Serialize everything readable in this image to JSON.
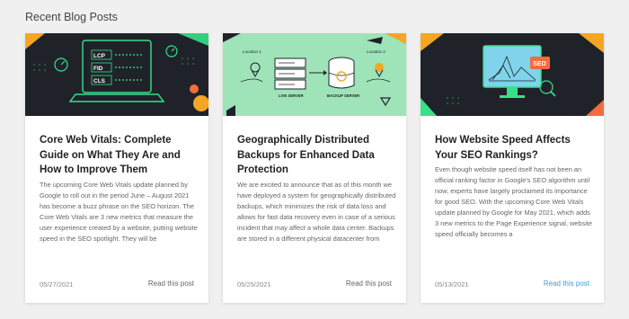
{
  "section": {
    "title": "Recent Blog Posts"
  },
  "posts": [
    {
      "image_alt": "core-web-vitals-laptop-illustration",
      "thumb_labels": [
        "LCP",
        "FID",
        "CLS"
      ],
      "title": "Core Web Vitals: Complete Guide on What They Are and How to Improve Them",
      "excerpt": "The upcoming Core Web Vitals update planned by Google to roll out in the period June – August 2021 has become a buzz phrase on the SEO horizon. The Core Web Vitals are 3 new metrics that measure the user experience created by a website, putting website speed in the SEO spotlight. They will be",
      "date": "05/27/2021",
      "link": "Read this post"
    },
    {
      "image_alt": "distributed-backups-illustration",
      "thumb_labels": [
        "Location 1",
        "Location 2",
        "LIVE SERVER",
        "BACKUP SERVER"
      ],
      "title": "Geographically Distributed Backups for Enhanced Data Protection",
      "excerpt": "We are excited to announce that as of this month we have deployed a system for geographically distributed backups, which minimizes the risk of data loss and allows for fast data recovery even in case of a serious incident that may affect a whole data center. Backups are stored in a different physical datacenter from",
      "date": "05/25/2021",
      "link": "Read this post"
    },
    {
      "image_alt": "website-speed-seo-monitor-illustration",
      "thumb_labels": [
        "SEO"
      ],
      "title": "How Website Speed Affects Your SEO Rankings?",
      "excerpt": "Even though website speed itself has not been an official ranking factor in Google's SEO algorithm until now, experts have largely proclaimed its importance for good SEO. With the upcoming Core Web Vitals update planned by Google for May 2021, which adds 3 new metrics to the Page Experience signal, website speed officially becomes a",
      "date": "05/13/2021",
      "link": "Read this post"
    }
  ],
  "colors": {
    "link_hover": "#3b9be0",
    "thumb_dark": "#1f2329",
    "thumb_green": "#9fe3b8",
    "accent_neon": "#39e08a",
    "accent_orange": "#f5a623"
  }
}
